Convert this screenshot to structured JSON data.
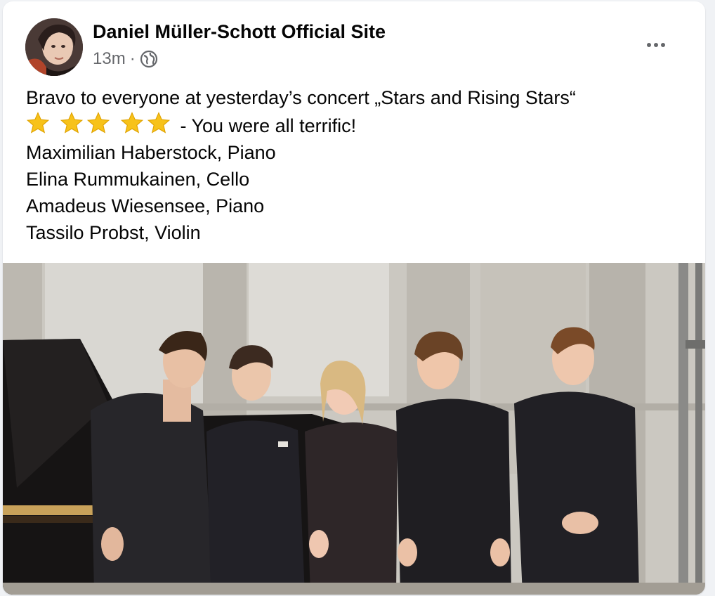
{
  "post": {
    "page_name": "Daniel Müller-Schott Official Site",
    "timestamp": "13m",
    "separator": "·",
    "audience_icon": "globe-icon",
    "more_icon": "more-horizontal-icon",
    "text_lines": [
      "Bravo to everyone at yesterday’s concert „Stars and Rising Stars“",
      " - You were all terrific!",
      "Maximilian Haberstock, Piano",
      "Elina Rummukainen, Cello",
      "Amadeus Wiesensee, Piano",
      "Tassilo Probst, Violin"
    ],
    "star_emoji_count": 5,
    "star_icon": "star-emoji-icon"
  },
  "colors": {
    "text_primary": "#050505",
    "text_secondary": "#65676b",
    "card_background": "#ffffff",
    "star": "#f7c21a"
  }
}
